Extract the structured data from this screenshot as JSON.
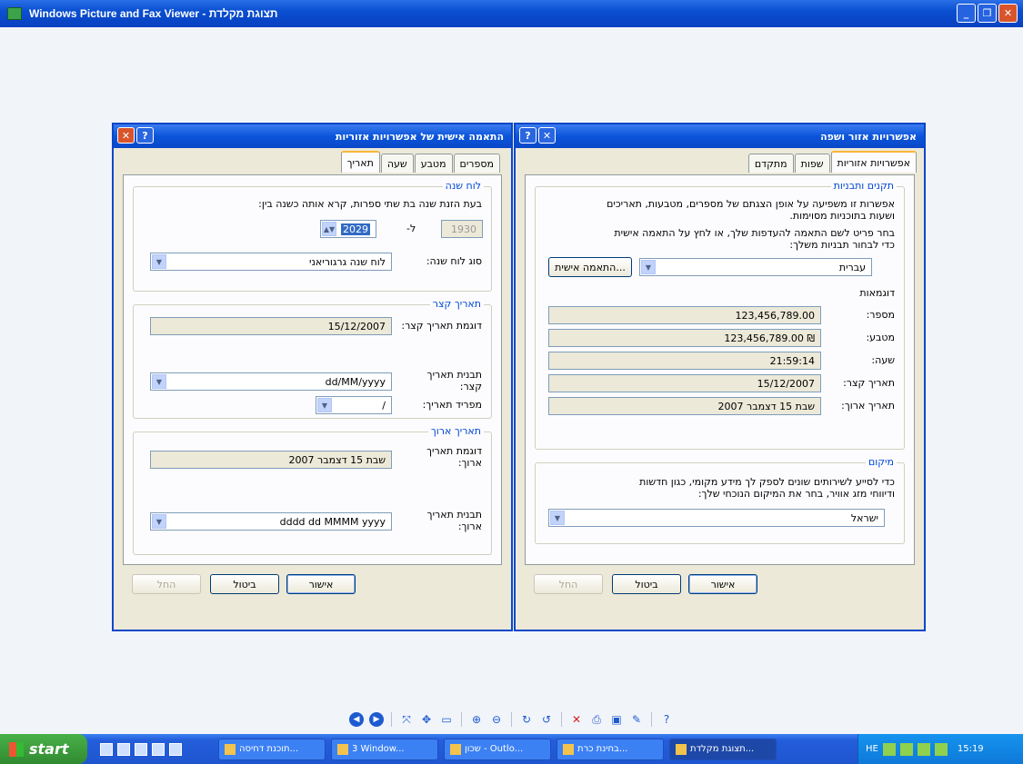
{
  "window": {
    "title": "Windows Picture and Fax Viewer - תצוגת מקלדת"
  },
  "dialog_right": {
    "title": "אפשרויות אזור ושפה",
    "tabs": [
      "אפשרויות אזוריות",
      "שפות",
      "מתקדם"
    ],
    "group_formats": {
      "legend": "תקנים ותבניות",
      "desc1": "אפשרות זו משפיעה על אופן הצגתם של מספרים, מטבעות, תאריכים",
      "desc2": "ושעות בתוכניות מסוימות.",
      "desc3": "בחר פריט לשם התאמה להעדפות שלך, או לחץ על התאמה אישית",
      "desc4": "כדי לבחור תבניות משלך:",
      "format_value": "עברית",
      "customize_button": "התאמה אישית...",
      "samples_label": "דוגמאות",
      "samples": [
        {
          "label": "מספר:",
          "value": "123,456,789.00"
        },
        {
          "label": "מטבע:",
          "value": "123,456,789.00 ₪"
        },
        {
          "label": "שעה:",
          "value": "21:59:14"
        },
        {
          "label": "תאריך קצר:",
          "value": "15/12/2007"
        },
        {
          "label": "תאריך ארוך:",
          "value": "שבת 15 דצמבר 2007"
        }
      ]
    },
    "group_location": {
      "legend": "מיקום",
      "desc1": "כדי לסייע לשירותים שונים לספק לך מידע מקומי, כגון חדשות",
      "desc2": "ודיווחי מזג אוויר, בחר את המיקום הנוכחי שלך:",
      "value": "ישראל"
    },
    "buttons": {
      "ok": "אישור",
      "cancel": "ביטול",
      "apply": "החל"
    }
  },
  "dialog_left": {
    "title": "התאמה אישית של אפשרויות אזוריות",
    "tabs": [
      "מספרים",
      "מטבע",
      "שעה",
      "תאריך"
    ],
    "group_calendar": {
      "legend": "לוח שנה",
      "desc": "בעת הזנת שנה בת שתי ספרות, קרא אותה כשנה בין:",
      "year_from": "1930",
      "to_label": "ל-",
      "year_to": "2029",
      "calendar_type_label": "סוג לוח שנה:",
      "calendar_type_value": "לוח שנה גרגוריאני"
    },
    "group_short": {
      "legend": "תאריך קצר",
      "sample_label": "דוגמת תאריך קצר:",
      "sample_value": "15/12/2007",
      "format_label": "תבנית תאריך קצר:",
      "format_value": "dd/MM/yyyy",
      "separator_label": "מפריד תאריך:",
      "separator_value": "/"
    },
    "group_long": {
      "legend": "תאריך ארוך",
      "sample_label": "דוגמת תאריך ארוך:",
      "sample_value": "שבת 15 דצמבר 2007",
      "format_label": "תבנית תאריך ארוך:",
      "format_value": "dddd dd MMMM yyyy"
    },
    "buttons": {
      "ok": "אישור",
      "cancel": "ביטול",
      "apply": "החל"
    }
  },
  "taskbar": {
    "start": "start",
    "tasks": [
      "תוכנת דחיסה...",
      "3 Window...",
      "שכון - Outlo...",
      "בחינת כרת...",
      "תצוגת מקלדת..."
    ],
    "lang": "HE",
    "clock": "15:19"
  }
}
